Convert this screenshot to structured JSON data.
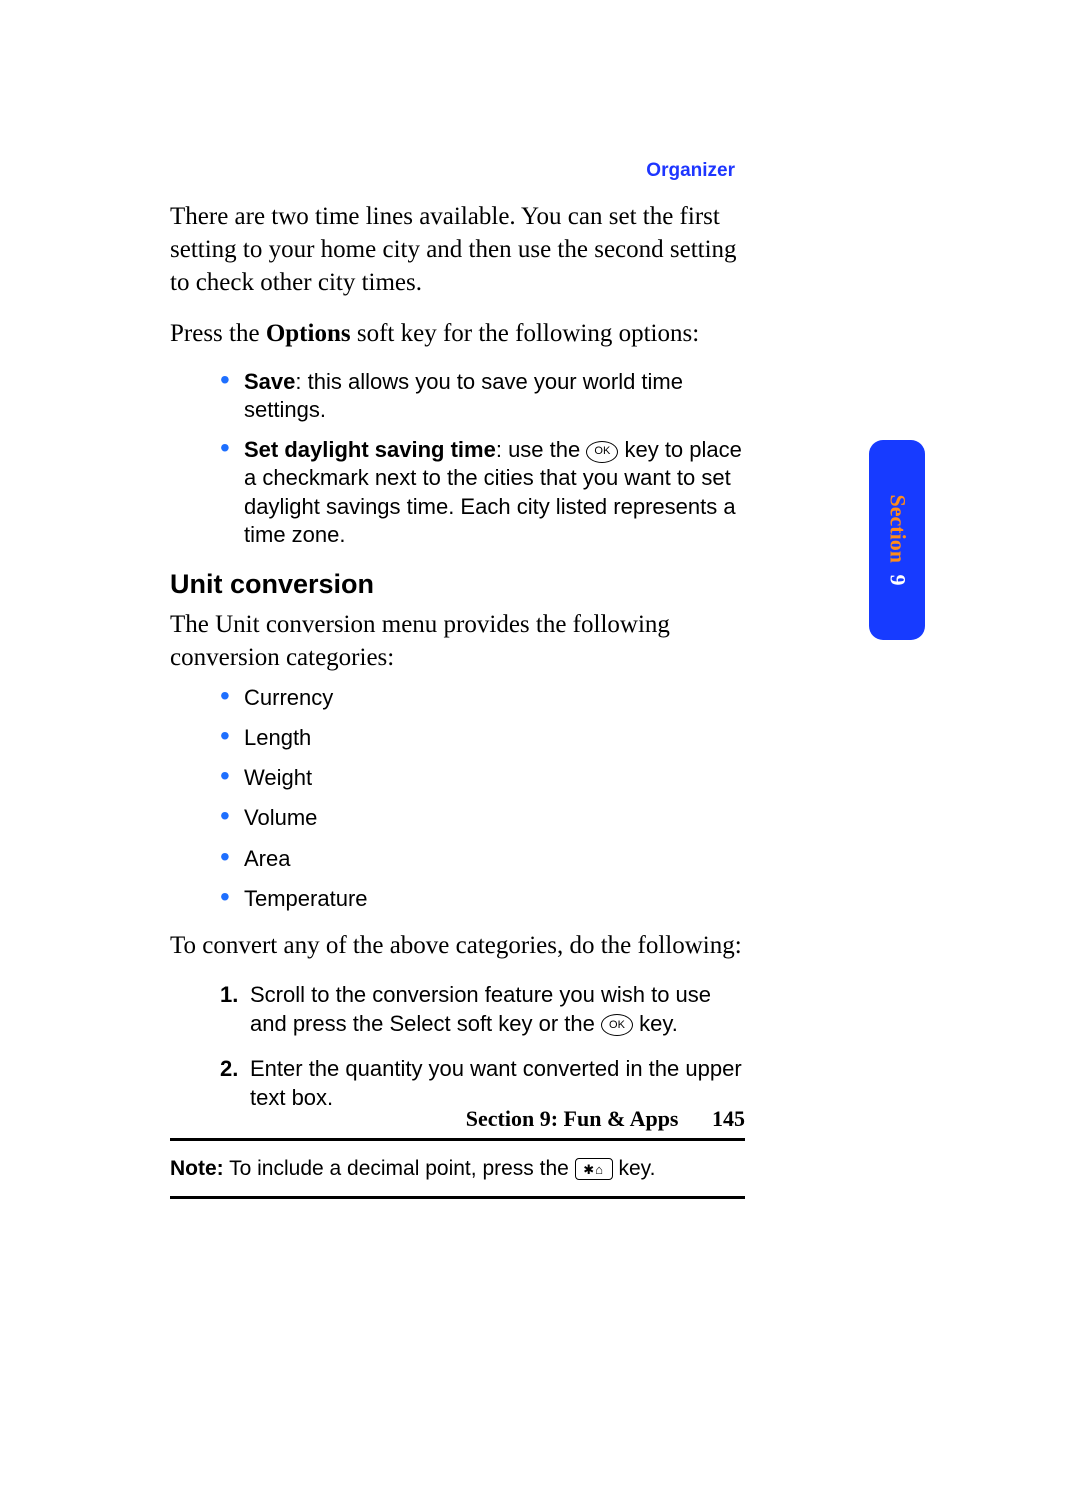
{
  "header": {
    "label": "Organizer"
  },
  "intro": {
    "p1": "There are two time lines available. You can set the first setting to your home city and then use the second setting to check other city times.",
    "p2_pre": "Press the ",
    "p2_bold": "Options",
    "p2_post": " soft key for the following options:"
  },
  "options_list": {
    "save_bold": "Save",
    "save_rest": ": this allows you to save your world time settings.",
    "dst_bold": "Set daylight saving time",
    "dst_rest1": ": use the ",
    "dst_ok": "OK",
    "dst_rest2": " key to place a checkmark next to the cities that you want to set daylight savings time. Each city listed represents a time zone."
  },
  "unit": {
    "heading": "Unit conversion",
    "intro": "The Unit conversion menu provides the following conversion categories:",
    "categories": [
      "Currency",
      "Length",
      "Weight",
      "Volume",
      "Area",
      "Temperature"
    ],
    "cta": "To convert any of the above categories, do the following:"
  },
  "steps": {
    "s1_pre": "Scroll to the conversion feature you wish to use and press the ",
    "s1_bold": "Select",
    "s1_mid": " soft key or the ",
    "s1_ok": "OK",
    "s1_post": " key.",
    "s2": "Enter the quantity you want converted in the upper text box."
  },
  "note": {
    "bold": "Note:",
    "pre": " To include a decimal point, press the ",
    "key": "✱⌂",
    "post": " key."
  },
  "sidetab": {
    "label": "Section",
    "number": "9"
  },
  "footer": {
    "title": "Section 9: Fun & Apps",
    "page": "145"
  }
}
